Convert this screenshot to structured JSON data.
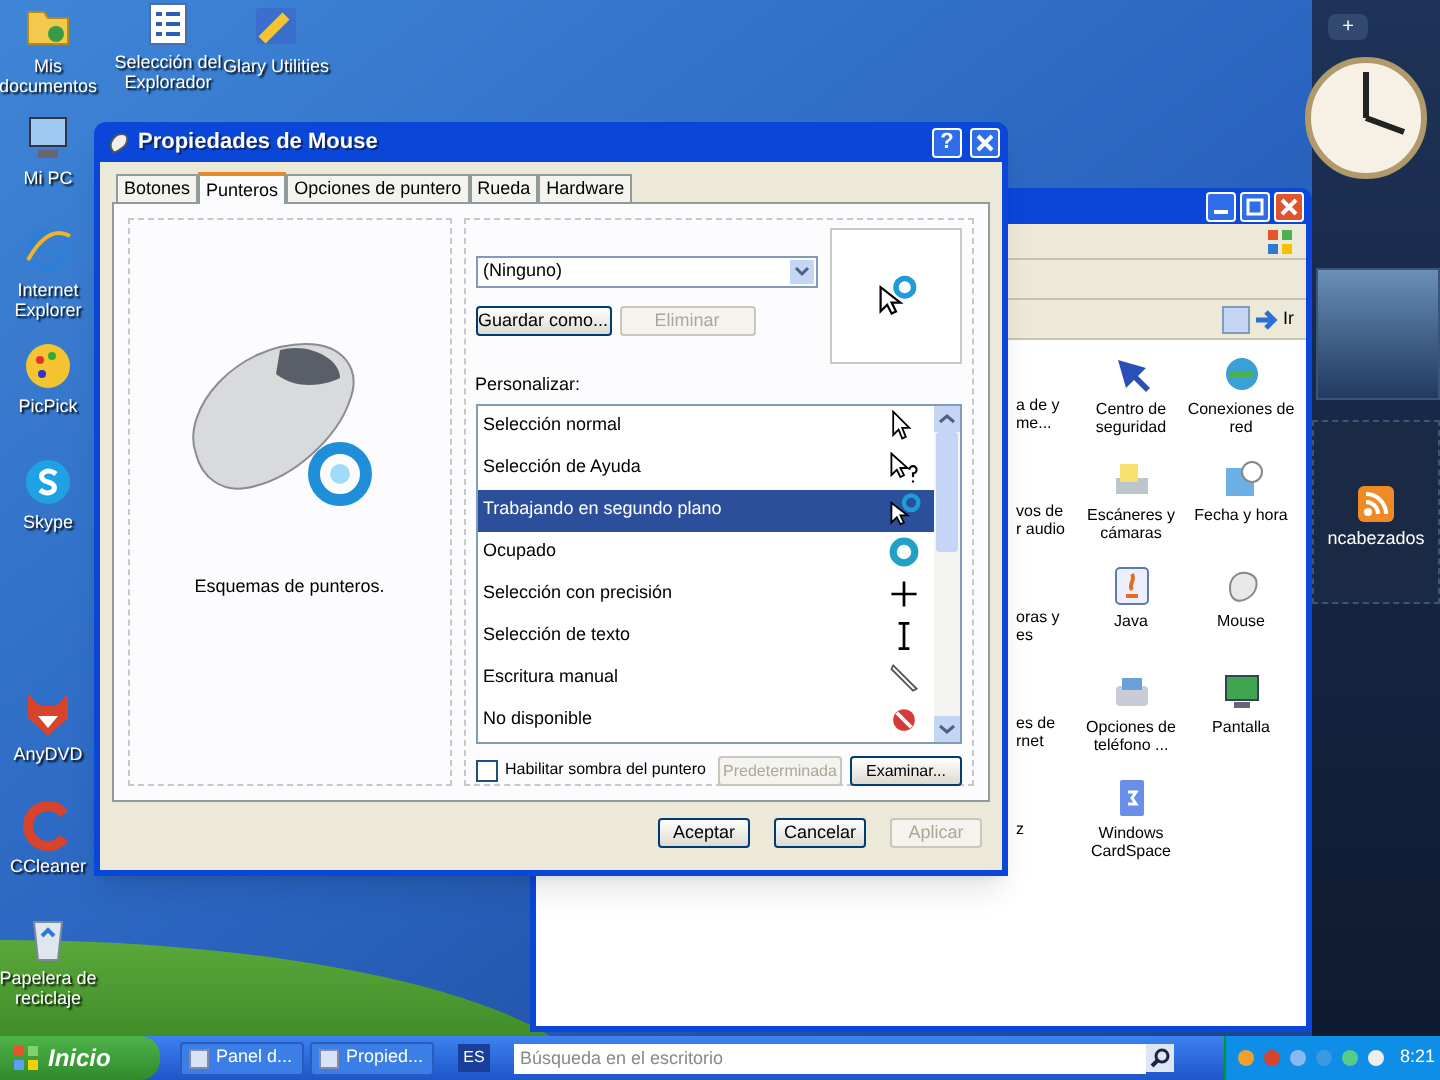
{
  "desktop_icons": [
    {
      "label": "Mis documentos"
    },
    {
      "label": "Selección del Explorador"
    },
    {
      "label": "Glary Utilities"
    },
    {
      "label": "Mi PC"
    },
    {
      "label": "Internet Explorer"
    },
    {
      "label": "PicPick"
    },
    {
      "label": "Skype"
    },
    {
      "label": "AnyDVD"
    },
    {
      "label": "CCleaner"
    },
    {
      "label": "Papelera de reciclaje"
    }
  ],
  "control_panel": {
    "go_button": "Ir",
    "partial_items": [
      "a de y me...",
      "vos de r audio",
      "oras y es",
      "es de rnet",
      "z"
    ],
    "items": [
      {
        "label": "Centro de seguridad"
      },
      {
        "label": "Conexiones de red"
      },
      {
        "label": "Escáneres y cámaras"
      },
      {
        "label": "Fecha y hora"
      },
      {
        "label": "Java"
      },
      {
        "label": "Mouse"
      },
      {
        "label": "Opciones de teléfono ..."
      },
      {
        "label": "Pantalla"
      },
      {
        "label": "Windows CardSpace"
      }
    ]
  },
  "sidebar": {
    "add_button": "+",
    "feed_label": "ncabezados"
  },
  "dialog": {
    "title": "Propiedades de Mouse",
    "help_button": "?",
    "tabs": [
      {
        "label": "Botones",
        "selected": false
      },
      {
        "label": "Punteros",
        "selected": true
      },
      {
        "label": "Opciones de puntero",
        "selected": false
      },
      {
        "label": "Rueda",
        "selected": false
      },
      {
        "label": "Hardware",
        "selected": false
      }
    ],
    "scheme_caption": "Esquemas de punteros.",
    "scheme_value": "(Ninguno)",
    "save_button": {
      "label": "Guardar como...",
      "disabled": false
    },
    "delete_button": {
      "label": "Eliminar",
      "disabled": true
    },
    "customize_label": "Personalizar:",
    "cursors": [
      {
        "label": "Selección normal",
        "selected": false
      },
      {
        "label": "Selección de Ayuda",
        "selected": false
      },
      {
        "label": "Trabajando en segundo plano",
        "selected": true
      },
      {
        "label": "Ocupado",
        "selected": false
      },
      {
        "label": "Selección con precisión",
        "selected": false
      },
      {
        "label": "Selección de texto",
        "selected": false
      },
      {
        "label": "Escritura manual",
        "selected": false
      },
      {
        "label": "No disponible",
        "selected": false
      }
    ],
    "shadow": {
      "label": "Habilitar sombra del puntero",
      "checked": false
    },
    "default_button": {
      "label": "Predeterminada",
      "disabled": true
    },
    "browse_button": {
      "label": "Examinar...",
      "disabled": false
    },
    "buttons": [
      {
        "label": "Aceptar",
        "disabled": false
      },
      {
        "label": "Cancelar",
        "disabled": false
      },
      {
        "label": "Aplicar",
        "disabled": true
      }
    ]
  },
  "taskbar": {
    "start": "Inicio",
    "tasks": [
      {
        "label": "Panel d..."
      },
      {
        "label": "Propied..."
      }
    ],
    "language": "ES",
    "search_placeholder": "Búsqueda en el escritorio",
    "clock": "8:21"
  }
}
